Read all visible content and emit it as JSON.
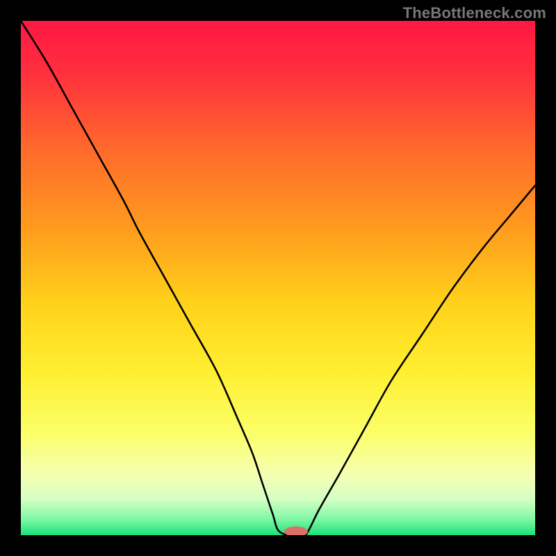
{
  "watermark": "TheBottleneck.com",
  "chart_data": {
    "type": "line",
    "title": "",
    "xlabel": "",
    "ylabel": "",
    "xlim": [
      0,
      100
    ],
    "ylim": [
      0,
      100
    ],
    "background_gradient_stops": [
      {
        "offset": 0.0,
        "color": "#ff1744"
      },
      {
        "offset": 0.1,
        "color": "#ff2f3d"
      },
      {
        "offset": 0.25,
        "color": "#ff6a2b"
      },
      {
        "offset": 0.4,
        "color": "#ff9a1e"
      },
      {
        "offset": 0.55,
        "color": "#ffd21a"
      },
      {
        "offset": 0.68,
        "color": "#ffee30"
      },
      {
        "offset": 0.8,
        "color": "#fbff67"
      },
      {
        "offset": 0.88,
        "color": "#f6ffb0"
      },
      {
        "offset": 0.93,
        "color": "#d6ffc4"
      },
      {
        "offset": 0.97,
        "color": "#7cf7a3"
      },
      {
        "offset": 1.0,
        "color": "#19e27a"
      }
    ],
    "series": [
      {
        "name": "bottleneck-curve",
        "x": [
          0,
          5,
          10,
          15,
          20,
          23,
          28,
          33,
          38,
          42,
          45,
          47,
          49,
          50,
          52,
          55,
          56,
          58,
          62,
          67,
          72,
          78,
          84,
          90,
          95,
          100
        ],
        "y": [
          100,
          92,
          83,
          74,
          65,
          59,
          50,
          41,
          32,
          23,
          16,
          10,
          4,
          1,
          0,
          0,
          1,
          5,
          12,
          21,
          30,
          39,
          48,
          56,
          62,
          68
        ]
      }
    ],
    "marker": {
      "x": 53.5,
      "y": 0.7,
      "color": "#d9716a",
      "rx": 2.3,
      "ry": 1.0
    }
  }
}
